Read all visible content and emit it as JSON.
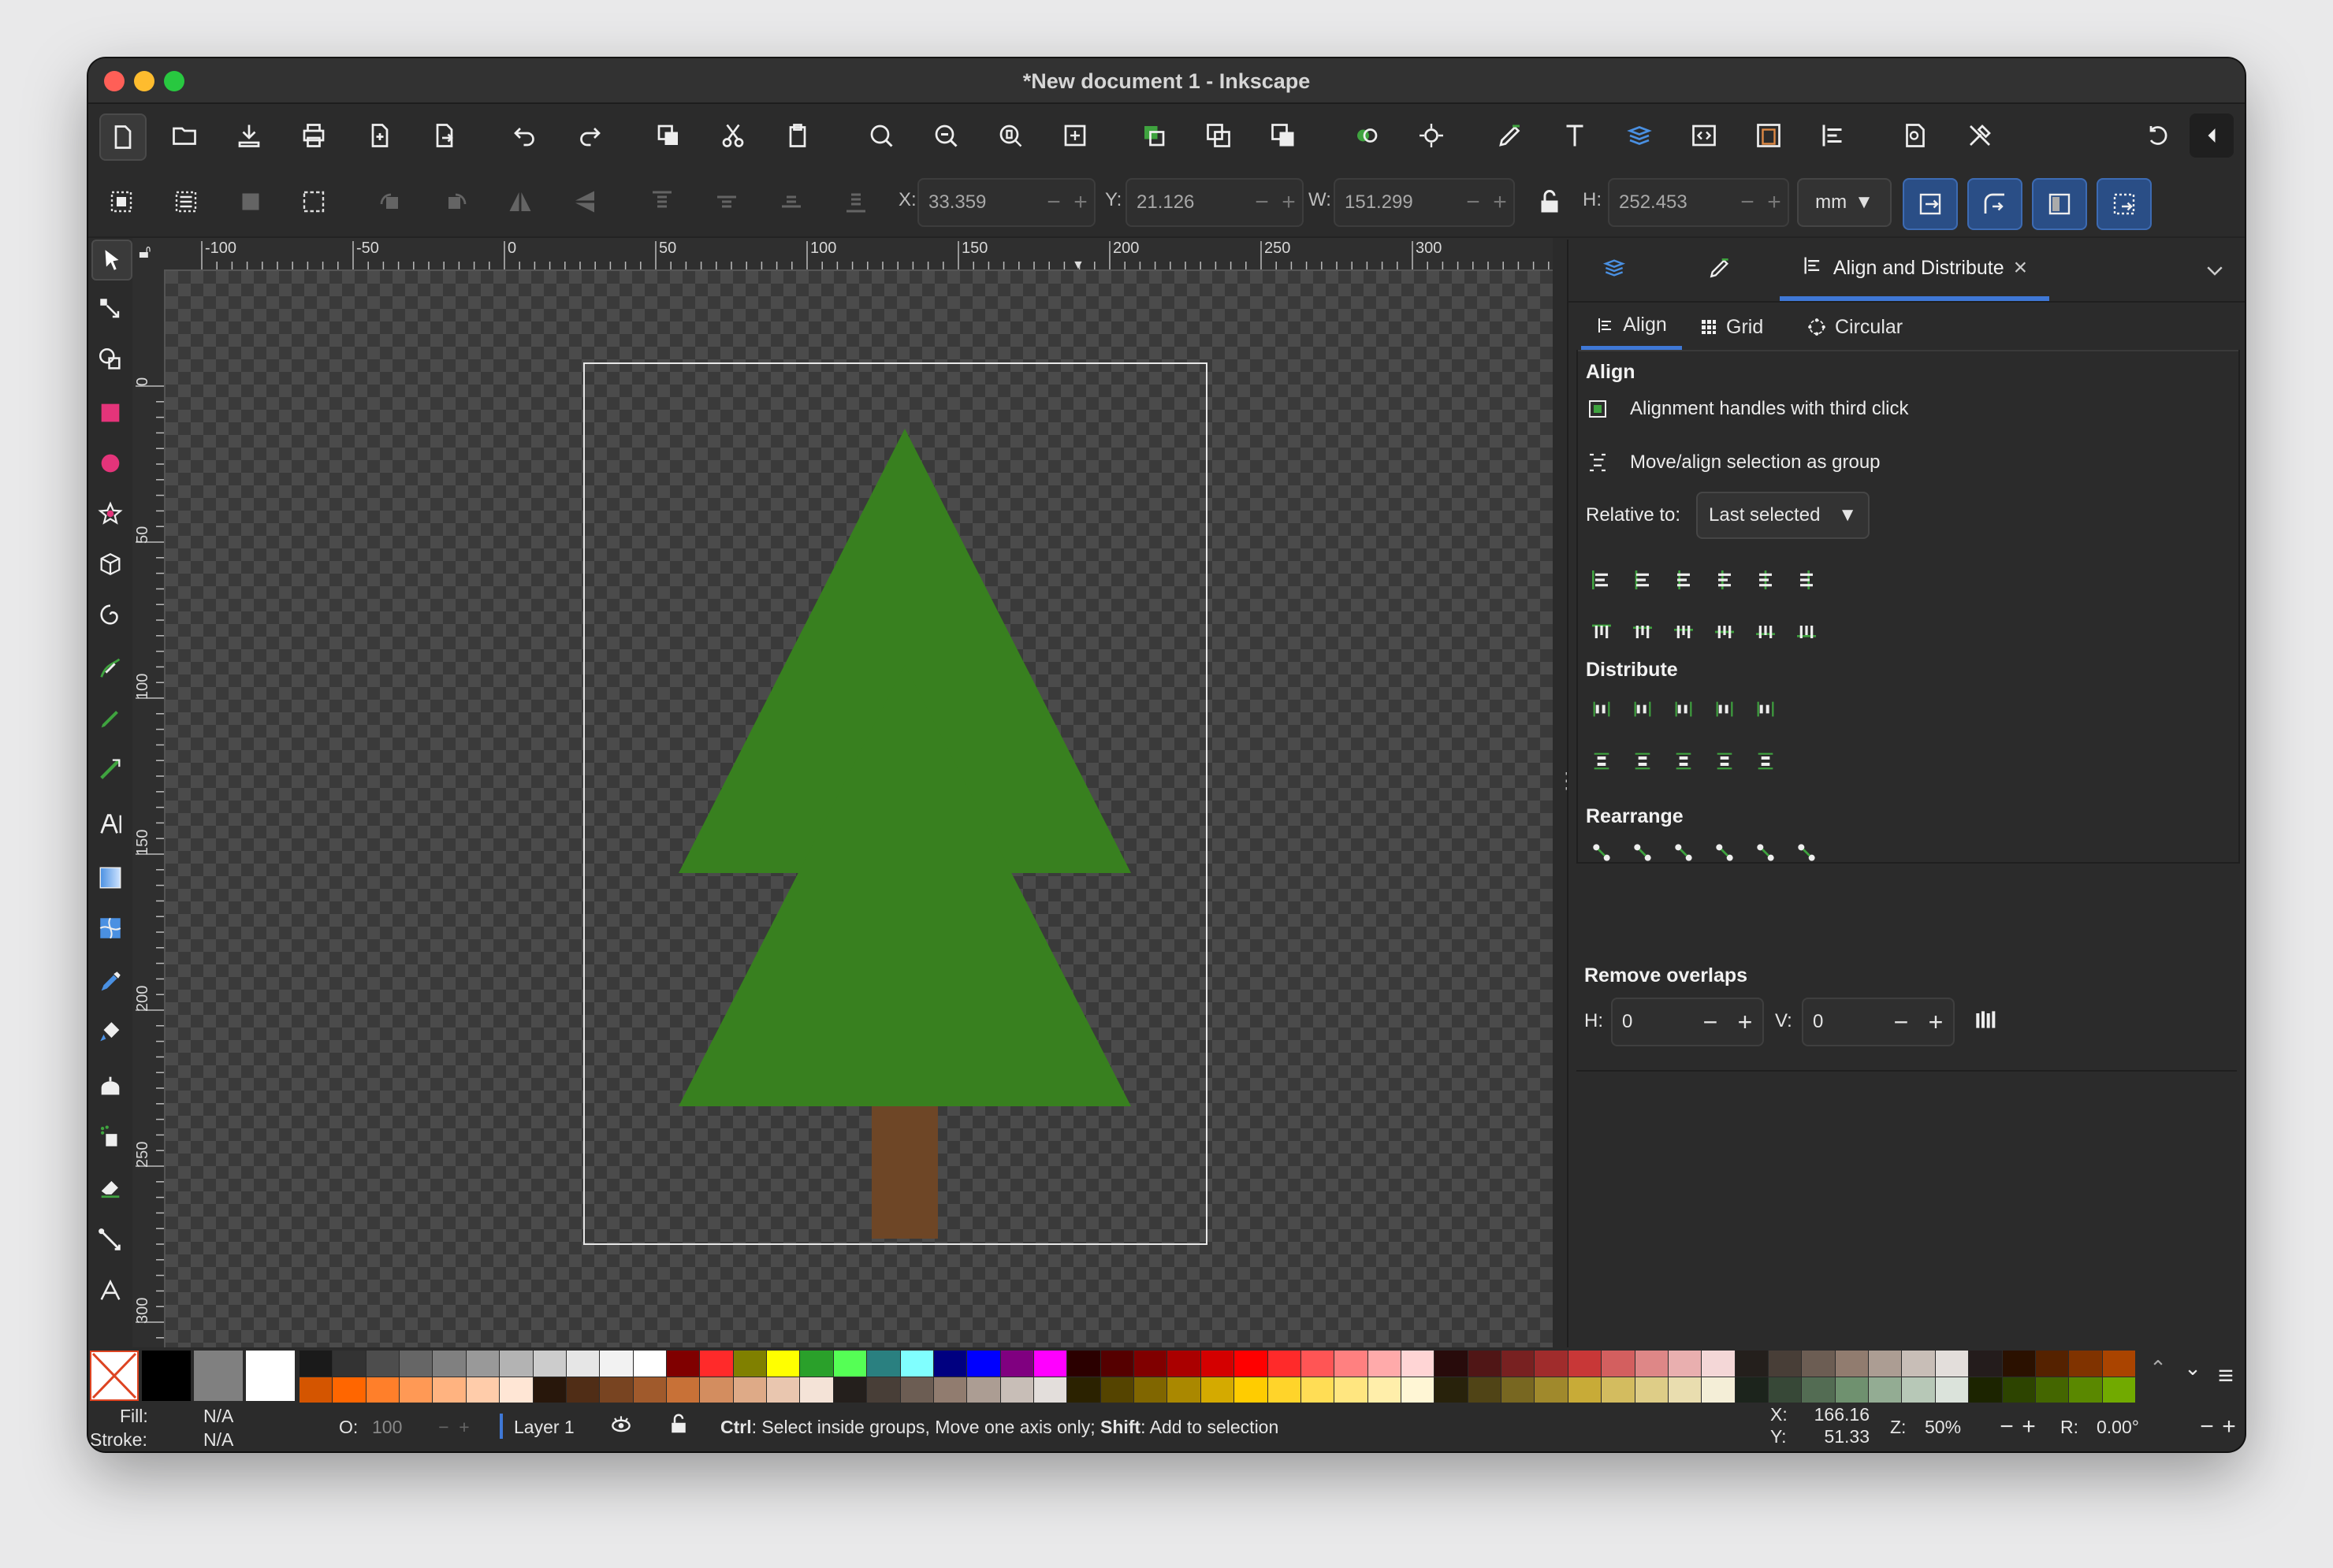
{
  "window": {
    "title": "*New document 1 - Inkscape"
  },
  "commands": {
    "icons": [
      "new-document",
      "open",
      "save",
      "print",
      "import",
      "export",
      "undo",
      "redo",
      "duplicate",
      "cut",
      "paste",
      "zoom-selection",
      "zoom-drawing",
      "zoom-page",
      "zoom-1-1",
      "group",
      "ungroup",
      "clone",
      "node",
      "dropper",
      "xml-fill",
      "text",
      "layers",
      "xml-editor",
      "doc-properties",
      "align",
      "document-properties",
      "preferences"
    ]
  },
  "controls": {
    "x_label": "X:",
    "x_value": "33.359",
    "y_label": "Y:",
    "y_value": "21.126",
    "w_label": "W:",
    "w_value": "151.299",
    "h_label": "H:",
    "h_value": "252.453",
    "units": "mm"
  },
  "rulers": {
    "top": [
      "-100",
      "-50",
      "0",
      "50",
      "100",
      "150",
      "200",
      "250",
      "300"
    ],
    "left": [
      "0",
      "50",
      "100",
      "150",
      "200",
      "250",
      "300"
    ]
  },
  "canvas": {
    "tree_green": "#38801f",
    "trunk_brown": "#6e4626",
    "page_border": "#e8e8e8"
  },
  "dock": {
    "tabs": [
      {
        "icon": "layers-icon",
        "label": ""
      },
      {
        "icon": "fill-stroke-icon",
        "label": ""
      },
      {
        "icon": "align-icon",
        "label": "Align and Distribute"
      }
    ],
    "close_glyph": "×",
    "subtabs": [
      {
        "label": "Align"
      },
      {
        "label": "Grid"
      },
      {
        "label": "Circular"
      }
    ],
    "align_heading": "Align",
    "opt_handles": "Alignment handles with third click",
    "opt_group": "Move/align selection as group",
    "relative_label": "Relative to:",
    "relative_value": "Last selected",
    "distribute_heading": "Distribute",
    "rearrange_heading": "Rearrange",
    "remove_heading": "Remove overlaps",
    "h_label": "H:",
    "h_value": "0",
    "v_label": "V:",
    "v_value": "0"
  },
  "status": {
    "fill_label": "Fill:",
    "fill_value": "N/A",
    "stroke_label": "Stroke:",
    "stroke_value": "N/A",
    "opacity_label": "O:",
    "opacity_value": "100",
    "layer": "Layer 1",
    "hint_ctrl": "Ctrl",
    "hint_1": ": Select inside groups, Move one axis only; ",
    "hint_shift": "Shift",
    "hint_2": ": Add to selection",
    "x_label": "X:",
    "x_value": "166.16",
    "y_label": "Y:",
    "y_value": "51.33",
    "zoom_label": "Z:",
    "zoom_value": "50%",
    "rot_label": "R:",
    "rot_value": "0.00°"
  },
  "palette": {
    "top": [
      "#1a1a1a",
      "#333333",
      "#4d4d4d",
      "#666666",
      "#808080",
      "#999999",
      "#b3b3b3",
      "#cccccc",
      "#e6e6e6",
      "#f2f2f2",
      "#ffffff",
      "#800000",
      "#ff2a2a",
      "#808000",
      "#ffff00",
      "#2aa02a",
      "#55ff55",
      "#2a8080",
      "#80ffff",
      "#000080",
      "#0000ff",
      "#800080",
      "#ff00ff",
      "#2b0000",
      "#550000",
      "#800000",
      "#aa0000",
      "#d40000",
      "#ff0000",
      "#ff2a2a",
      "#ff5555",
      "#ff8080",
      "#ffaaaa",
      "#ffd5d5",
      "#280b0b",
      "#501616",
      "#782121",
      "#a02c2c",
      "#c83737",
      "#d35f5f",
      "#de8787",
      "#e9afaf",
      "#f4d7d7",
      "#241f1c",
      "#483e37",
      "#6c5d53",
      "#917c6f",
      "#ac9d93",
      "#c8beb7",
      "#e3dedb",
      "#241c1c",
      "#2b1100",
      "#552200",
      "#803300",
      "#aa4400"
    ],
    "bottom": [
      "#d45500",
      "#ff6600",
      "#ff7f2a",
      "#ff9955",
      "#ffb380",
      "#ffccaa",
      "#ffe6d5",
      "#28170b",
      "#502d16",
      "#784421",
      "#a05a2c",
      "#c87137",
      "#d38d5f",
      "#deaa87",
      "#e9c6af",
      "#f4e3d7",
      "#241f1c",
      "#483e37",
      "#6c5d53",
      "#917c6f",
      "#ac9d93",
      "#c8beb7",
      "#e3dedb",
      "#2b2200",
      "#554400",
      "#806600",
      "#aa8800",
      "#d4aa00",
      "#ffcc00",
      "#ffd42a",
      "#ffdd55",
      "#ffe680",
      "#ffeeaa",
      "#fff6d5",
      "#28220b",
      "#504416",
      "#786721",
      "#a0892c",
      "#c8ab37",
      "#d3bc5f",
      "#decd87",
      "#e9ddaf",
      "#f4eed7",
      "#1c241c",
      "#374837",
      "#536c53",
      "#6f916f",
      "#93ac93",
      "#b7c8b7",
      "#dbe3db",
      "#1c2400",
      "#2d4400",
      "#446600",
      "#5a8800",
      "#71aa00"
    ]
  }
}
